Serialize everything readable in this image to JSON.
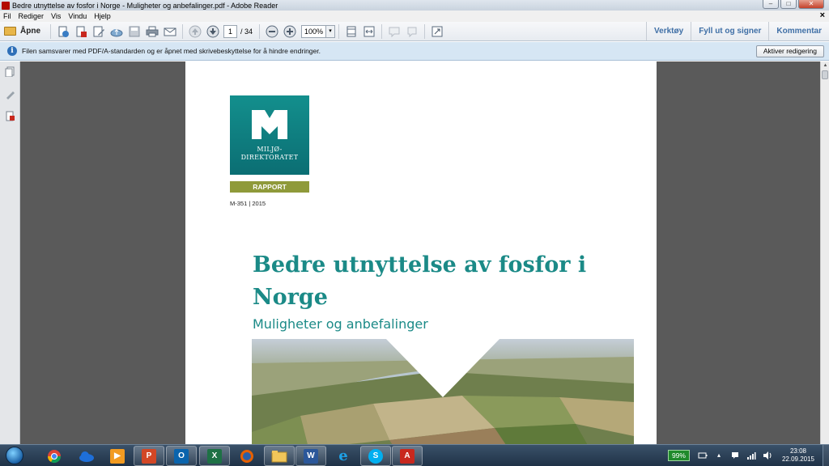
{
  "window": {
    "title": "Bedre utnyttelse av fosfor i Norge - Muligheter og anbefalinger.pdf - Adobe Reader",
    "controls": {
      "minimize": "–",
      "maximize": "□",
      "close": "✕"
    }
  },
  "menubar": {
    "items": [
      "Fil",
      "Rediger",
      "Vis",
      "Vindu",
      "Hjelp"
    ],
    "doc_close": "×"
  },
  "toolbar": {
    "open_label": "Åpne",
    "page_current": "1",
    "page_total": "/ 34",
    "zoom": "100%",
    "zoom_dropdown": "▾",
    "panels": [
      "Verktøy",
      "Fyll ut og signer",
      "Kommentar"
    ]
  },
  "infobar": {
    "icon": "i",
    "message": "Filen samsvarer med PDF/A-standarden og er åpnet med skrivebeskyttelse for å hindre endringer.",
    "button": "Aktiver redigering"
  },
  "document": {
    "logo_text_line1": "MILJØ-",
    "logo_text_line2": "DIREKTORATET",
    "badge": "RAPPORT",
    "report_number": "M-351 | 2015",
    "title": "Bedre utnyttelse av fosfor i Norge",
    "subtitle": "Muligheter og anbefalinger",
    "colors": {
      "teal": "#1b8a87",
      "olive": "#8f9a3a"
    }
  },
  "taskbar": {
    "apps": [
      "chrome",
      "onedrive",
      "media-player",
      "powerpoint",
      "outlook",
      "excel",
      "firefox",
      "explorer",
      "word",
      "internet-explorer",
      "skype",
      "adobe-reader"
    ],
    "battery": "99%",
    "time": "23:08",
    "date": "22.09.2015"
  }
}
